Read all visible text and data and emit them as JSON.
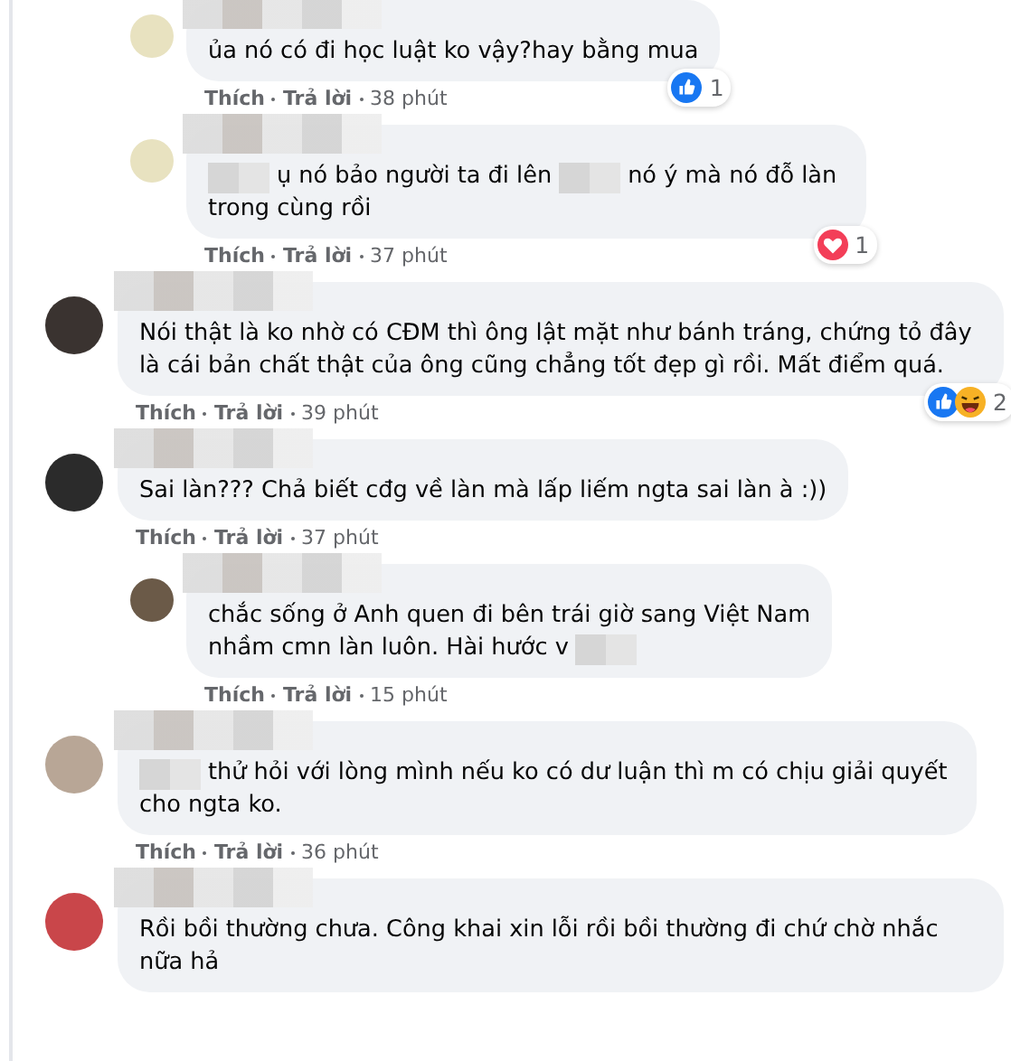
{
  "earlier_replies": [
    {
      "lines": [
        [
          {
            "kind": "text",
            "text": "ủa nó có đi học luật ko vậy?hay bằng mua"
          }
        ]
      ],
      "reactions": [
        {
          "kind": "like"
        }
      ],
      "reaction_count": "1",
      "like": "Thích",
      "reply": "Trả lời",
      "time": "38 phút"
    },
    {
      "lines": [
        [
          {
            "kind": "blur"
          },
          {
            "kind": "text",
            "text": "ụ nó bảo người ta đi lên"
          },
          {
            "kind": "blur"
          },
          {
            "kind": "text",
            "text": "nó ý mà nó đỗ làn"
          }
        ],
        [
          {
            "kind": "text",
            "text": "trong cùng rồi"
          }
        ]
      ],
      "reactions": [
        {
          "kind": "love"
        }
      ],
      "reaction_count": "1",
      "like": "Thích",
      "reply": "Trả lời",
      "time": "37 phút"
    }
  ],
  "comments": [
    {
      "lines": [
        [
          {
            "kind": "text",
            "text": "Nói thật là ko nhờ có CĐM thì ông lật mặt như bánh tráng, chứng tỏ đây là cái bản chất thật của ông cũng chẳng tốt đẹp gì rồi. Mất điểm quá."
          }
        ]
      ],
      "reactions": [
        {
          "kind": "like"
        },
        {
          "kind": "haha"
        }
      ],
      "reaction_count": "2",
      "like": "Thích",
      "reply": "Trả lời",
      "time": "39 phút"
    },
    {
      "lines": [
        [
          {
            "kind": "text",
            "text": "Sai làn??? Chả biết cđg về làn mà lấp liếm ngta sai làn à :))"
          }
        ]
      ],
      "like": "Thích",
      "reply": "Trả lời",
      "time": "37 phút",
      "children": [
        {
          "lines": [
            [
              {
                "kind": "text",
                "text": "chắc sống ở Anh quen đi bên trái giờ sang Việt Nam"
              }
            ],
            [
              {
                "kind": "text",
                "text": "nhầm cmn làn luôn. Hài hước v"
              },
              {
                "kind": "blur"
              }
            ]
          ],
          "like": "Thích",
          "reply": "Trả lời",
          "time": "15 phút"
        }
      ]
    },
    {
      "lines": [
        [
          {
            "kind": "blur"
          },
          {
            "kind": "text",
            "text": "thử hỏi với lòng mình nếu ko có dư luận thì m có chịu giải quyết"
          }
        ],
        [
          {
            "kind": "text",
            "text": "cho ngta ko."
          }
        ]
      ],
      "like": "Thích",
      "reply": "Trả lời",
      "time": "36 phút"
    },
    {
      "lines": [
        [
          {
            "kind": "text",
            "text": "Rồi bồi thường chưa. Công khai xin lỗi rồi bồi thường đi chứ chờ nhắc nữa hả"
          }
        ]
      ]
    }
  ]
}
